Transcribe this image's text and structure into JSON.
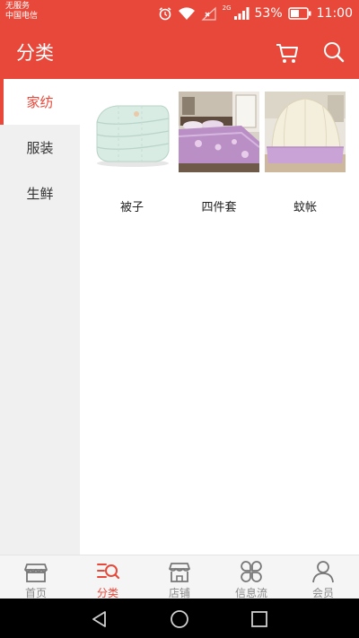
{
  "status_bar": {
    "carrier_line1": "无服务",
    "carrier_line2": "中国电信",
    "network_tag": "2G",
    "battery_percent": "53%",
    "time": "11:00",
    "icons": [
      "alarm-icon",
      "wifi-icon",
      "no-sim-signal-icon",
      "cellular-signal-icon",
      "battery-icon"
    ]
  },
  "header": {
    "title": "分类",
    "icons": [
      "cart-icon",
      "search-icon"
    ]
  },
  "sidebar": {
    "items": [
      {
        "label": "家纺",
        "active": true
      },
      {
        "label": "服装",
        "active": false
      },
      {
        "label": "生鲜",
        "active": false
      }
    ]
  },
  "products": [
    {
      "name": "被子",
      "image": "quilt"
    },
    {
      "name": "四件套",
      "image": "bedding-set"
    },
    {
      "name": "蚊帐",
      "image": "mosquito-net"
    }
  ],
  "tab_bar": {
    "tabs": [
      {
        "label": "首页",
        "icon": "storefront-icon",
        "active": false
      },
      {
        "label": "分类",
        "icon": "category-icon",
        "active": true
      },
      {
        "label": "店铺",
        "icon": "shop-icon",
        "active": false
      },
      {
        "label": "信息流",
        "icon": "feed-icon",
        "active": false
      },
      {
        "label": "会员",
        "icon": "member-icon",
        "active": false
      }
    ]
  },
  "nav_bar": {
    "buttons": [
      "back-icon",
      "home-icon",
      "recents-icon"
    ]
  },
  "colors": {
    "accent": "#e8483a",
    "sidebar_bg": "#f0f0f0",
    "tab_inactive": "#8a8a8a"
  }
}
